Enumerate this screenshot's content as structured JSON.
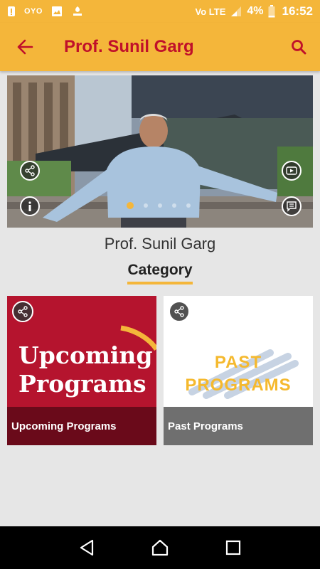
{
  "status_bar": {
    "app_icons": [
      "alert-icon",
      "ovo-icon",
      "image-icon",
      "pepe-icon"
    ],
    "ovo_label": "OYO",
    "network_label": "Vo LTE",
    "battery": "4%",
    "time": "16:52"
  },
  "app_bar": {
    "title": "Prof. Sunil Garg"
  },
  "banner": {
    "slide_count": 5,
    "active_slide": 1
  },
  "profile": {
    "name": "Prof. Sunil Garg"
  },
  "category": {
    "heading": "Category",
    "cards": [
      {
        "art_line1": "Upcoming",
        "art_line2": "Programs",
        "caption": "Upcoming Programs"
      },
      {
        "art_line1": "PAST",
        "art_line2": "PROGRAMS",
        "caption": "Past Programs"
      }
    ]
  },
  "colors": {
    "app_bar": "#f4b63a",
    "title": "#c0102a",
    "upcoming_card": "#b5142e",
    "past_text": "#f5b92e"
  }
}
